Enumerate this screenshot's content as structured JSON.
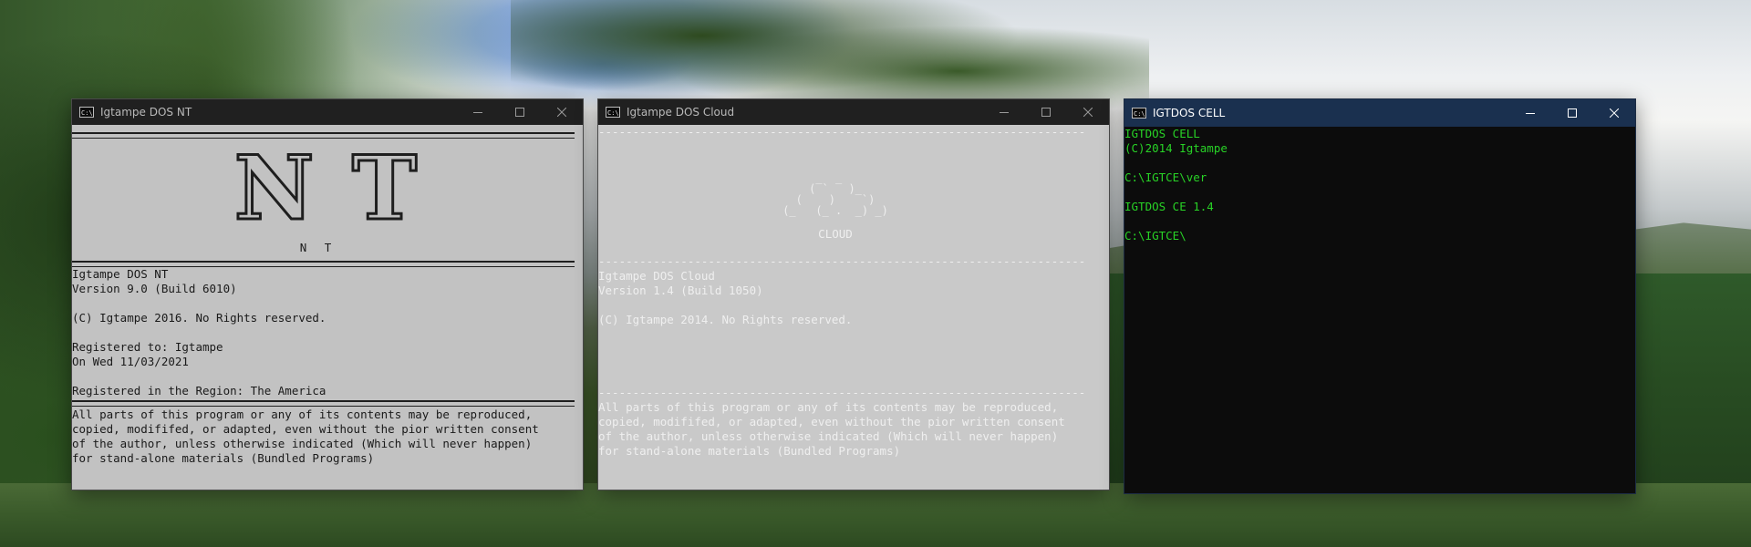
{
  "windows": {
    "nt": {
      "title": "Igtampe DOS NT",
      "icon": "command-prompt-icon",
      "logo_letters": "N T",
      "caption": "N T",
      "info_lines": [
        "Igtampe DOS NT",
        "Version 9.0 (Build 6010)",
        "",
        "(C) Igtampe 2016. No Rights reserved.",
        "",
        "Registered to: Igtampe",
        "On Wed 11/03/2021",
        "",
        "Registered in the Region: The America"
      ],
      "notice_lines": [
        "All parts of this program or any of its contents may be reproduced,",
        "copied, modififed, or adapted, even without the pior written consent",
        "of the author, unless otherwise indicated (Which will never happen)",
        "for stand-alone materials (Bundled Programs)"
      ]
    },
    "cloud": {
      "title": "Igtampe DOS Cloud",
      "icon": "command-prompt-icon",
      "separator": "-----------------------------------------------------------------------",
      "ascii_art": [
        "  _  _    ",
        " ( `   )_ ",
        "(    )    `)",
        "(_   (_ .  _) _)"
      ],
      "caption": "CLOUD",
      "info_lines": [
        "Igtampe DOS Cloud",
        "Version 1.4 (Build 1050)",
        "",
        "(C) Igtampe 2014. No Rights reserved."
      ],
      "notice_lines": [
        "All parts of this program or any of its contents may be reproduced,",
        "copied, modififed, or adapted, even without the pior written consent",
        "of the author, unless otherwise indicated (Which will never happen)",
        "for stand-alone materials (Bundled Programs)"
      ]
    },
    "cell": {
      "title": "IGTDOS CELL",
      "icon": "command-prompt-icon",
      "lines": [
        "IGTDOS CELL",
        "(C)2014 Igtampe",
        "",
        "C:\\IGTCE\\ver",
        "",
        "IGTDOS CE 1.4",
        "",
        "C:\\IGTCE\\"
      ]
    }
  },
  "controls": {
    "minimize": "minimize-icon",
    "maximize": "maximize-icon",
    "close": "close-icon"
  },
  "colors": {
    "nt_console_bg": "#c2c2c2",
    "cloud_console_bg": "#c9c9c9",
    "cell_console_bg": "#0c0c0c",
    "cell_text": "#28d226",
    "cell_titlebar": "#1a304f"
  }
}
